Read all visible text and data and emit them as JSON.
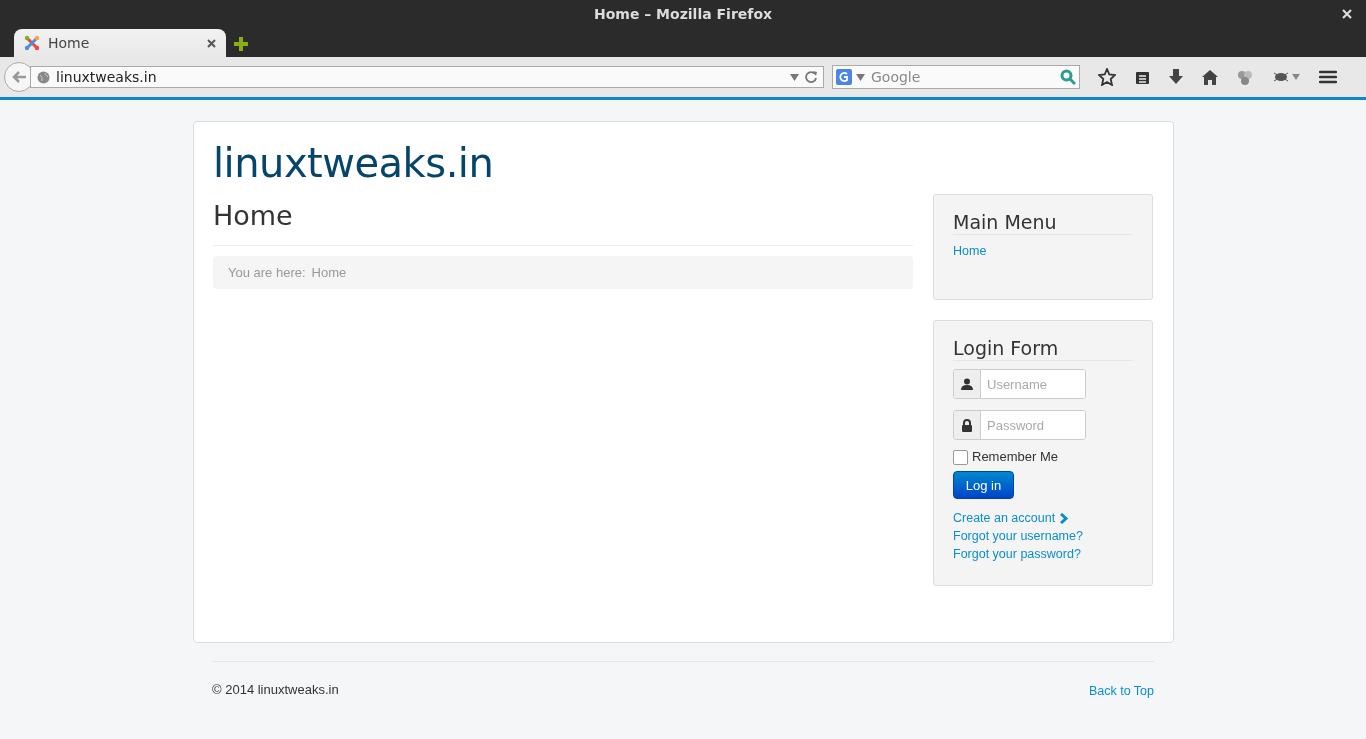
{
  "window": {
    "title": "Home – Mozilla Firefox"
  },
  "tabs": [
    {
      "label": "Home",
      "selected": true
    }
  ],
  "address": {
    "value": "linuxtweaks.in"
  },
  "search": {
    "placeholder": "Google"
  },
  "site": {
    "title": "linuxtweaks.in"
  },
  "page": {
    "heading": "Home",
    "breadcrumb_label": "You are here:",
    "breadcrumb_item": "Home"
  },
  "main_menu": {
    "title": "Main Menu",
    "items": [
      {
        "label": "Home"
      }
    ]
  },
  "login": {
    "title": "Login Form",
    "username_placeholder": "Username",
    "password_placeholder": "Password",
    "remember": {
      "label": "Remember Me",
      "checked": false
    },
    "button": "Log in",
    "links": [
      {
        "label": "Create an account",
        "chevron": true
      },
      {
        "label": "Forgot your username?",
        "chevron": false
      },
      {
        "label": "Forgot your password?",
        "chevron": false
      }
    ]
  },
  "footer": {
    "copyright": "© 2014 linuxtweaks.in",
    "back_to_top": "Back to Top"
  }
}
